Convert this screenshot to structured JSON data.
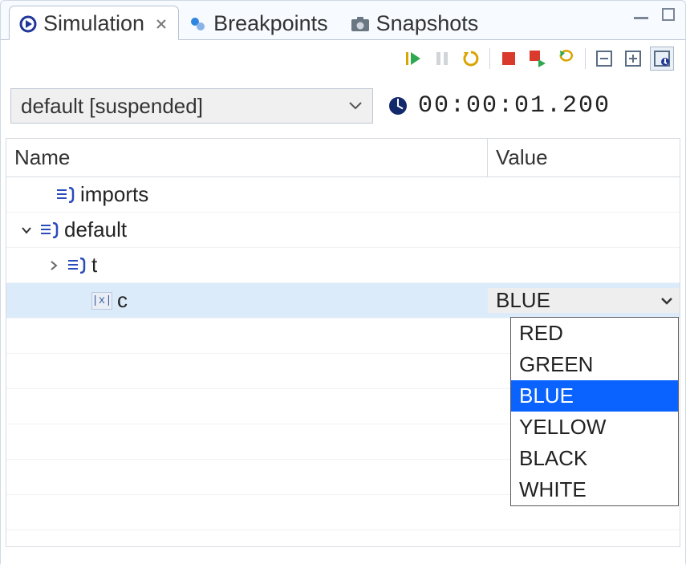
{
  "tabs": {
    "simulation": "Simulation",
    "breakpoints": "Breakpoints",
    "snapshots": "Snapshots"
  },
  "thread_select": "default [suspended]",
  "sim_time": "00:00:01.200",
  "table": {
    "col_name": "Name",
    "col_value": "Value",
    "rows": {
      "imports": "imports",
      "default": "default",
      "t": "t",
      "c": "c",
      "c_value": "BLUE"
    }
  },
  "dropdown": {
    "options": [
      "RED",
      "GREEN",
      "BLUE",
      "YELLOW",
      "BLACK",
      "WHITE"
    ],
    "selected": "BLUE"
  }
}
